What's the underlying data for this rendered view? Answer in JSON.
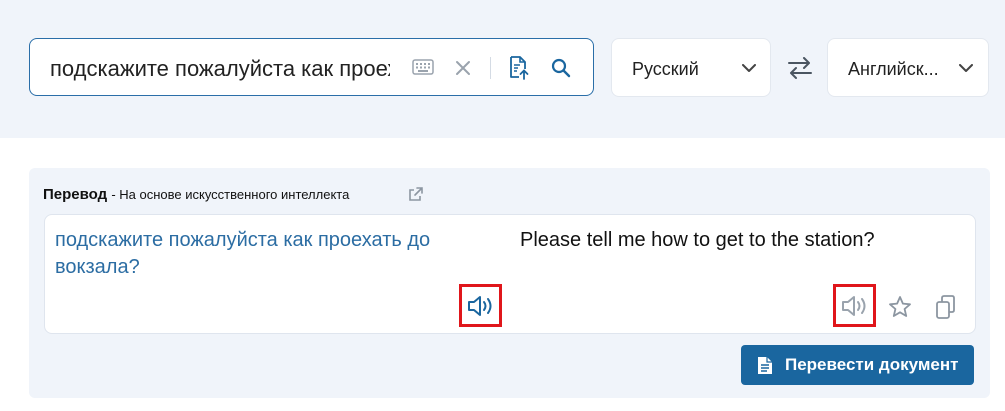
{
  "search": {
    "value": "подскажите пожалуйста как проехать до вокзала?",
    "icons": [
      "keyboard-icon",
      "clear-icon",
      "upload-document-icon",
      "search-icon"
    ]
  },
  "languages": {
    "source": "Русский",
    "target": "Английск...",
    "swap_icon": "swap-arrows-icon",
    "dropdown_icon": "chevron-down-icon"
  },
  "translation": {
    "title": "Перевод",
    "subtitle": "- На основе искусственного интеллекта",
    "source_text": "подскажите пожалуйста как проехать до вокзала?",
    "target_text": "Please tell me how to get to the station?",
    "actions": [
      "speaker-icon",
      "star-icon",
      "copy-icon",
      "external-link-icon"
    ]
  },
  "buttons": {
    "translate_document": "Перевести документ"
  },
  "colors": {
    "accent": "#1a669f",
    "source_text": "#2c6da3",
    "highlight": "#e0161b",
    "band_background": "#f0f4fa"
  }
}
